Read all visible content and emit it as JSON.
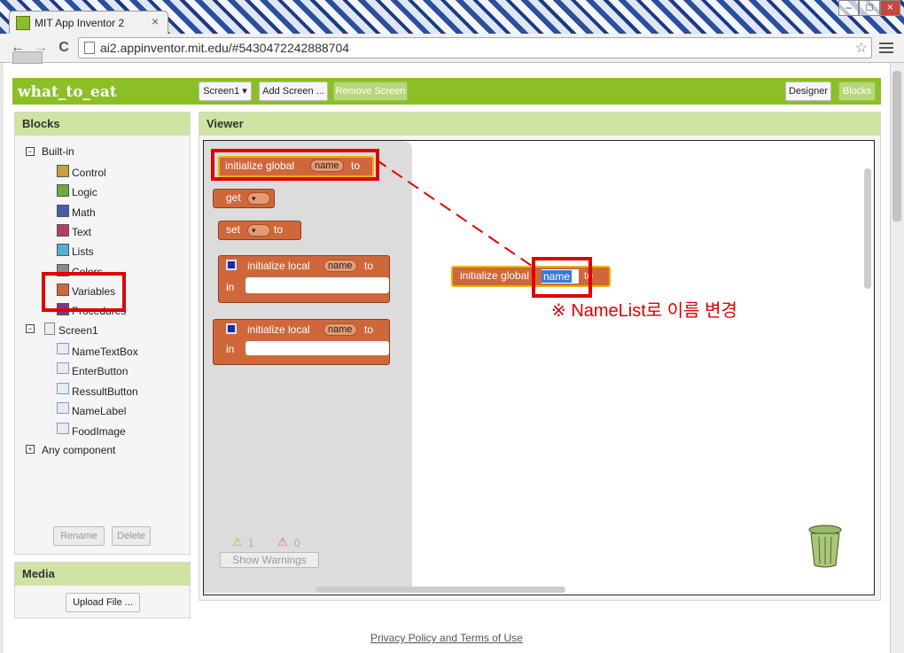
{
  "browser": {
    "tab_title": "MIT App Inventor 2",
    "tab_close": "×",
    "url": "ai2.appinventor.mit.edu/#5430472242888704",
    "window_controls": [
      "–",
      "□",
      "×"
    ],
    "star": "☆",
    "back": "←",
    "forward": "→",
    "reload": "C"
  },
  "app": {
    "project_name": "what_to_eat",
    "screen_select": "Screen1 ▾",
    "add_screen": "Add Screen ...",
    "remove_screen": "Remove Screen",
    "designer": "Designer",
    "blocks": "Blocks"
  },
  "blocks_panel": {
    "title": "Blocks",
    "builtin_label": "Built-in",
    "builtin_items": [
      {
        "label": "Control",
        "color": "#c8a03f"
      },
      {
        "label": "Logic",
        "color": "#6faa3c"
      },
      {
        "label": "Math",
        "color": "#3f5fa8"
      },
      {
        "label": "Text",
        "color": "#b83a6a"
      },
      {
        "label": "Lists",
        "color": "#52aed4"
      },
      {
        "label": "Colors",
        "color": "#8a8a8a"
      },
      {
        "label": "Variables",
        "color": "#d0673a"
      },
      {
        "label": "Procedures",
        "color": "#7a3a8a"
      }
    ],
    "screen_label": "Screen1",
    "components": [
      "NameTextBox",
      "EnterButton",
      "RessultButton",
      "NameLabel",
      "FoodImage"
    ],
    "any_component": "Any component",
    "rename": "Rename",
    "delete": "Delete"
  },
  "media_panel": {
    "title": "Media",
    "upload": "Upload File ..."
  },
  "viewer": {
    "title": "Viewer",
    "flyout": {
      "init_global": {
        "prefix": "initialize global",
        "name": "name",
        "suffix": "to"
      },
      "get": {
        "label": "get",
        "dropdown": "▾"
      },
      "set": {
        "label": "set",
        "dropdown": "▾",
        "suffix": "to"
      },
      "init_local_1": {
        "prefix": "initialize local",
        "name": "name",
        "suffix": "to",
        "in": "in"
      },
      "init_local_2": {
        "prefix": "initialize local",
        "name": "name",
        "suffix": "to",
        "in": "in"
      }
    },
    "warnings": {
      "warn_count": "1",
      "error_count": "0",
      "show_label": "Show Warnings"
    },
    "workspace_block": {
      "prefix": "initialize global",
      "name_editing": "name",
      "suffix": "to"
    },
    "annotation": "※ NameList로 이름 변경"
  },
  "footer": {
    "link": "Privacy Policy and Terms of Use"
  }
}
